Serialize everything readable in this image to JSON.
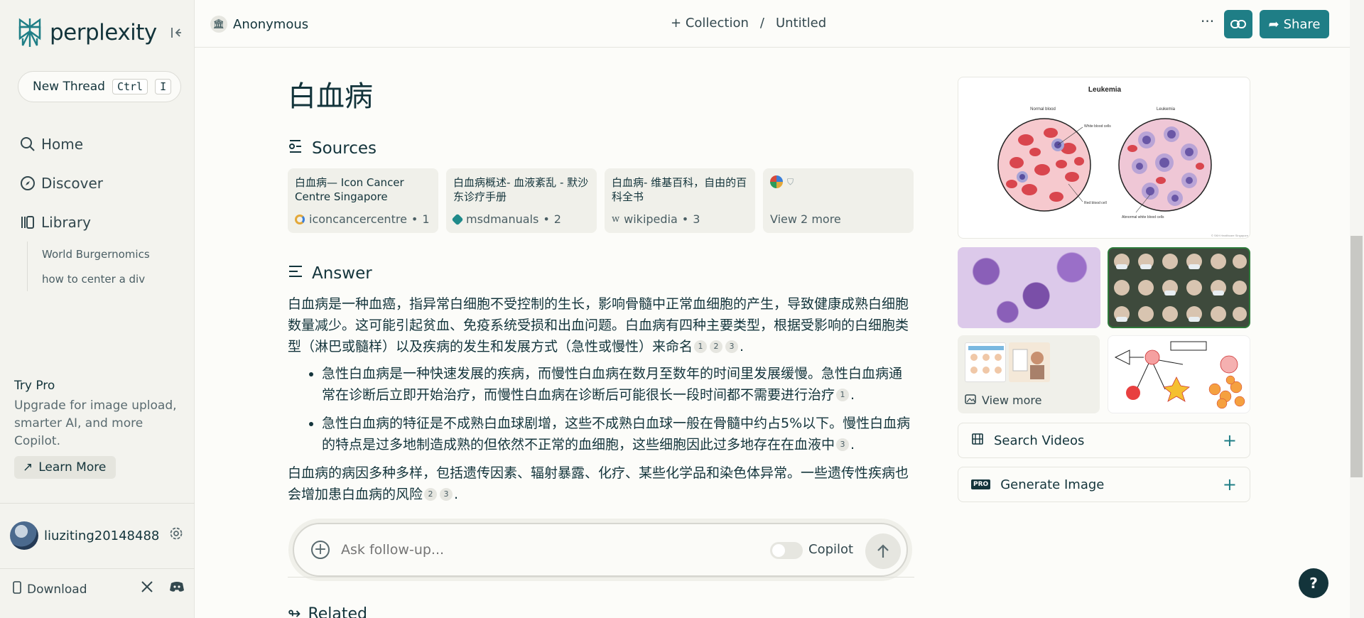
{
  "sidebar": {
    "logo_text": "perplexity",
    "new_thread_label": "New Thread",
    "shortcut_ctrl": "Ctrl",
    "shortcut_key": "I",
    "nav": [
      {
        "label": "Home",
        "icon": "search-icon"
      },
      {
        "label": "Discover",
        "icon": "compass-icon"
      },
      {
        "label": "Library",
        "icon": "library-icon"
      }
    ],
    "library_items": [
      "World Burgernomics",
      "how to center a div"
    ],
    "try_pro_title": "Try Pro",
    "try_pro_desc": "Upgrade for image upload, smarter AI, and more Copilot.",
    "learn_more_label": "Learn More",
    "username": "liuziting20148488",
    "download_label": "Download"
  },
  "header": {
    "user_label": "Anonymous",
    "collection_label": "Collection",
    "separator": "/",
    "thread_name": "Untitled",
    "share_label": "Share"
  },
  "main": {
    "title": "白血病",
    "sources_heading": "Sources",
    "sources": [
      {
        "title": "白血病— Icon Cancer Centre Singapore",
        "site": "iconcancercentre",
        "index": "1"
      },
      {
        "title": "白血病概述- 血液紊乱 - 默沙东诊疗手册",
        "site": "msdmanuals",
        "index": "2"
      },
      {
        "title": "白血病- 维基百科，自由的百科全书",
        "site": "wikipedia",
        "index": "3"
      }
    ],
    "view_more_sources": "View 2 more",
    "answer_heading": "Answer",
    "answer_p1": "白血病是一种血癌，指异常白细胞不受控制的生长，影响骨髓中正常血细胞的产生，导致健康成熟白细胞数量减少。这可能引起贫血、免疫系统受损和出血问题。白血病有四种主要类型，根据受影响的白细胞类型（淋巴或髓样）以及疾病的发生和发展方式（急性或慢性）来命名",
    "answer_bullet1": "急性白血病是一种快速发展的疾病，而慢性白血病在数月至数年的时间里发展缓慢。急性白血病通常在诊断后立即开始治疗，而慢性白血病在诊断后可能很长一段时间都不需要进行治疗",
    "answer_bullet2": "急性白血病的特征是不成熟白血球剧增，这些不成熟白血球一般在骨髓中约占5%以下。慢性白血病的特点是过多地制造成熟的但依然不正常的血细胞，这些细胞因此过多地存在在血液中",
    "answer_p2": "白血病的病因多种多样，包括遗传因素、辐射暴露、化疗、某些化学品和染色体异常。一些遗传性疾病也会增加患白血病的风险",
    "cite_1": "1",
    "cite_2": "2",
    "cite_3": "3",
    "ask_placeholder": "Ask follow-up...",
    "copilot_label": "Copilot",
    "related_heading": "Related"
  },
  "right": {
    "main_image": {
      "title": "Leukemia",
      "left_label": "Normal blood",
      "right_label": "Leukemia",
      "wbc_label": "White blood cells",
      "rbc_label": "Red blood cell",
      "abnormal_label": "Abnormal white blood cells",
      "watermark": "© SKH Healthcare Singapore"
    },
    "view_more_images": "View more",
    "search_videos_label": "Search Videos",
    "generate_image_label": "Generate Image",
    "pro_badge": "PRO"
  },
  "help_label": "?"
}
